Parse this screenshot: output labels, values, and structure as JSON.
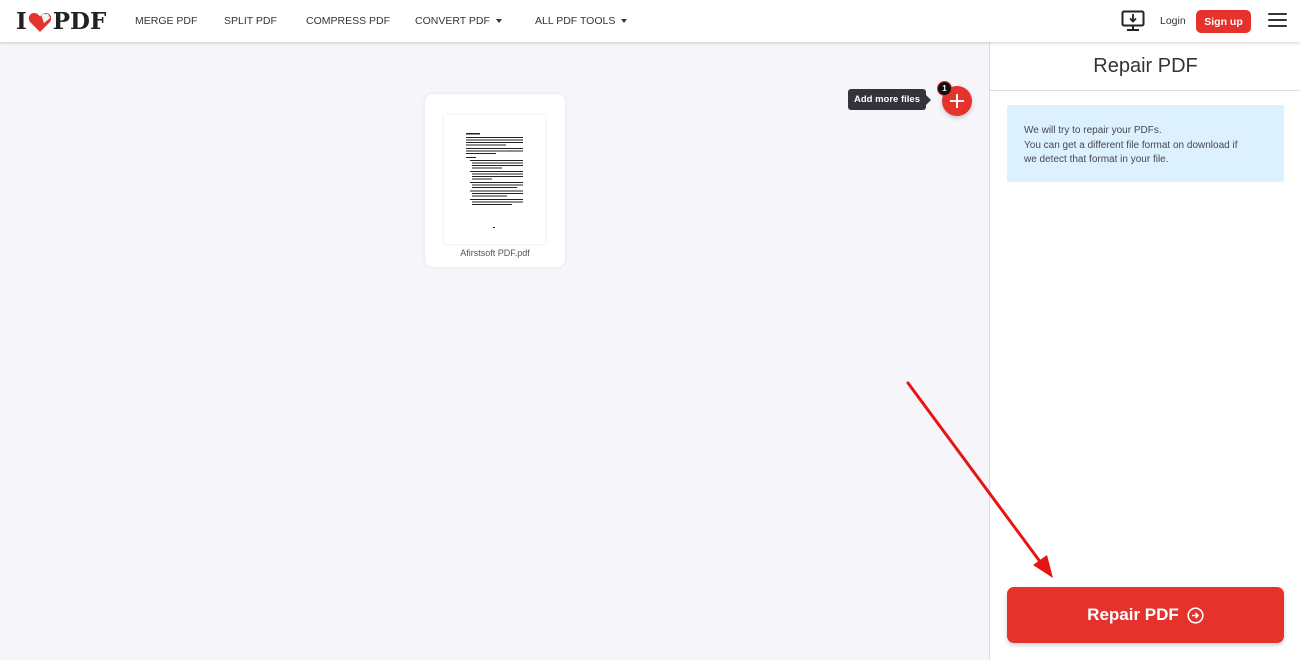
{
  "header": {
    "logo_left": "I",
    "logo_right": "PDF",
    "nav": [
      {
        "label": "MERGE PDF",
        "dropdown": false
      },
      {
        "label": "SPLIT PDF",
        "dropdown": false
      },
      {
        "label": "COMPRESS PDF",
        "dropdown": false
      },
      {
        "label": "CONVERT PDF",
        "dropdown": true
      },
      {
        "label": "ALL PDF TOOLS",
        "dropdown": true
      }
    ],
    "desktop_icon": "desktop-download-icon",
    "login_label": "Login",
    "signup_label": "Sign up",
    "menu_icon": "hamburger-menu-icon"
  },
  "workspace": {
    "files": [
      {
        "name": "Afirstsoft PDF.pdf"
      }
    ],
    "add_more_tooltip": "Add more files",
    "file_count_badge": "1"
  },
  "sidebar": {
    "title": "Repair PDF",
    "info_lines": [
      "We will try to repair your PDFs.",
      "You can get a different file format on download if",
      "we detect that format in your file."
    ],
    "action_label": "Repair PDF"
  },
  "colors": {
    "brand_red": "#e5322d",
    "info_bg": "#dcf0fe",
    "workspace_bg": "#f5f5fa",
    "annotation_arrow": "#e81313"
  }
}
